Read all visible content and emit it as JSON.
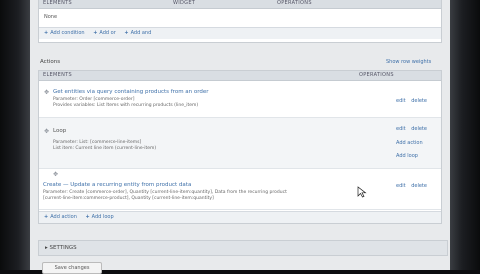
{
  "top_table": {
    "headers": [
      "ELEMENTS",
      "WIDGET",
      "OPERATIONS"
    ],
    "empty_text": "None",
    "add_links": [
      "Add condition",
      "Add or",
      "Add and"
    ]
  },
  "actions": {
    "title": "Actions",
    "show_weights": "Show row weights",
    "headers": [
      "ELEMENTS",
      "OPERATIONS"
    ],
    "rows": [
      {
        "title": "Get entities via query containing products from an order",
        "line1": "Parameter: Order [commerce-order]",
        "line2": "Provides variables: List Items with recurring products (line_item)",
        "ops": [
          "edit",
          "delete"
        ]
      },
      {
        "title": "Loop",
        "line1": "Parameter: List: [commerce-line-items]",
        "line2": "List item: Current line item (current-line-item)",
        "ops": [
          "edit",
          "delete"
        ],
        "extra": [
          "Add action",
          "Add loop"
        ]
      },
      {
        "title": "Create — Update a recurring entity from product data",
        "line1": "Parameter: Create [commerce-order], Quantity [current-line-item:quantity], Data from the recurring product",
        "line2": "[current-line-item:commerce-product], Quantity [current-line-item:quantity]",
        "ops": [
          "edit",
          "delete"
        ]
      }
    ],
    "add_links": [
      "Add action",
      "Add loop"
    ]
  },
  "settings": {
    "label": "SETTINGS"
  },
  "save_button": {
    "label": "Save changes"
  }
}
